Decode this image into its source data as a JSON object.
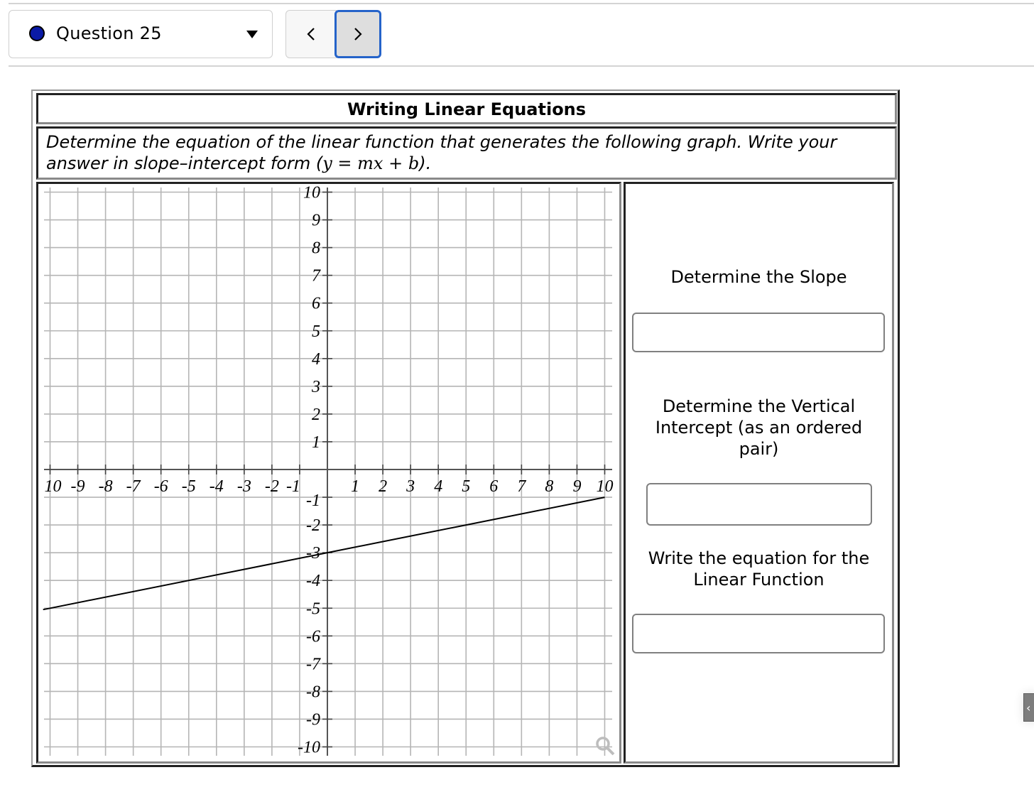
{
  "toolbar": {
    "question_selector": {
      "label": "Question 25",
      "status_color": "#0a1aa6"
    },
    "prev_button": {
      "glyph": "<",
      "icon": "chevron-left-icon"
    },
    "next_button": {
      "glyph": ">",
      "icon": "chevron-right-icon",
      "focused": true,
      "focus_color": "#2563c9"
    }
  },
  "problem": {
    "title": "Writing Linear Equations",
    "prompt_line1": "Determine the equation of the linear function that generates the following graph. Write your",
    "prompt_line2_prefix": "answer in slope–intercept form (",
    "prompt_math": {
      "y": "y",
      "eq": " = ",
      "m": "m",
      "x": "x",
      "plus": " + ",
      "b": "b"
    },
    "prompt_line2_suffix": ")."
  },
  "questions": [
    {
      "label": "Determine the Slope",
      "value": "",
      "placeholder": ""
    },
    {
      "label": "Determine the Vertical Intercept (as an ordered pair)",
      "value": "",
      "placeholder": ""
    },
    {
      "label": "Write the equation for the Linear Function",
      "value": "",
      "placeholder": ""
    }
  ],
  "graph_tools": {
    "zoom_icon": "magnifier-icon"
  },
  "edge_widget": {
    "glyph": "‹"
  },
  "chart_data": {
    "type": "line",
    "title": "",
    "xlabel": "",
    "ylabel": "",
    "xlim": [
      -10.25,
      10
    ],
    "ylim": [
      -10,
      10
    ],
    "grid": true,
    "x_ticks": [
      -10,
      -9,
      -8,
      -7,
      -6,
      -5,
      -4,
      -3,
      -2,
      -1,
      1,
      2,
      3,
      4,
      5,
      6,
      7,
      8,
      9,
      10
    ],
    "x_tick_labels": [
      "10",
      "-9",
      "-8",
      "-7",
      "-6",
      "-5",
      "-4",
      "-3",
      "-2",
      "-1",
      "1",
      "2",
      "3",
      "4",
      "5",
      "6",
      "7",
      "8",
      "9",
      "10"
    ],
    "y_ticks": [
      10,
      9,
      8,
      7,
      6,
      5,
      4,
      3,
      2,
      1,
      -1,
      -2,
      -3,
      -4,
      -5,
      -6,
      -7,
      -8,
      -9,
      -10
    ],
    "y_tick_labels": [
      "10",
      "9",
      "8",
      "7",
      "6",
      "5",
      "4",
      "3",
      "2",
      "1",
      "-1",
      "-2",
      "-3",
      "-4",
      "-5",
      "-6",
      "-7",
      "-8",
      "-9",
      "-10"
    ],
    "series": [
      {
        "name": "line",
        "slope": 0.2,
        "intercept": -3,
        "x": [
          -10.25,
          -10,
          -5,
          0,
          5,
          10
        ],
        "y": [
          -5.05,
          -5,
          -4,
          -3,
          -2,
          -1
        ]
      }
    ]
  }
}
